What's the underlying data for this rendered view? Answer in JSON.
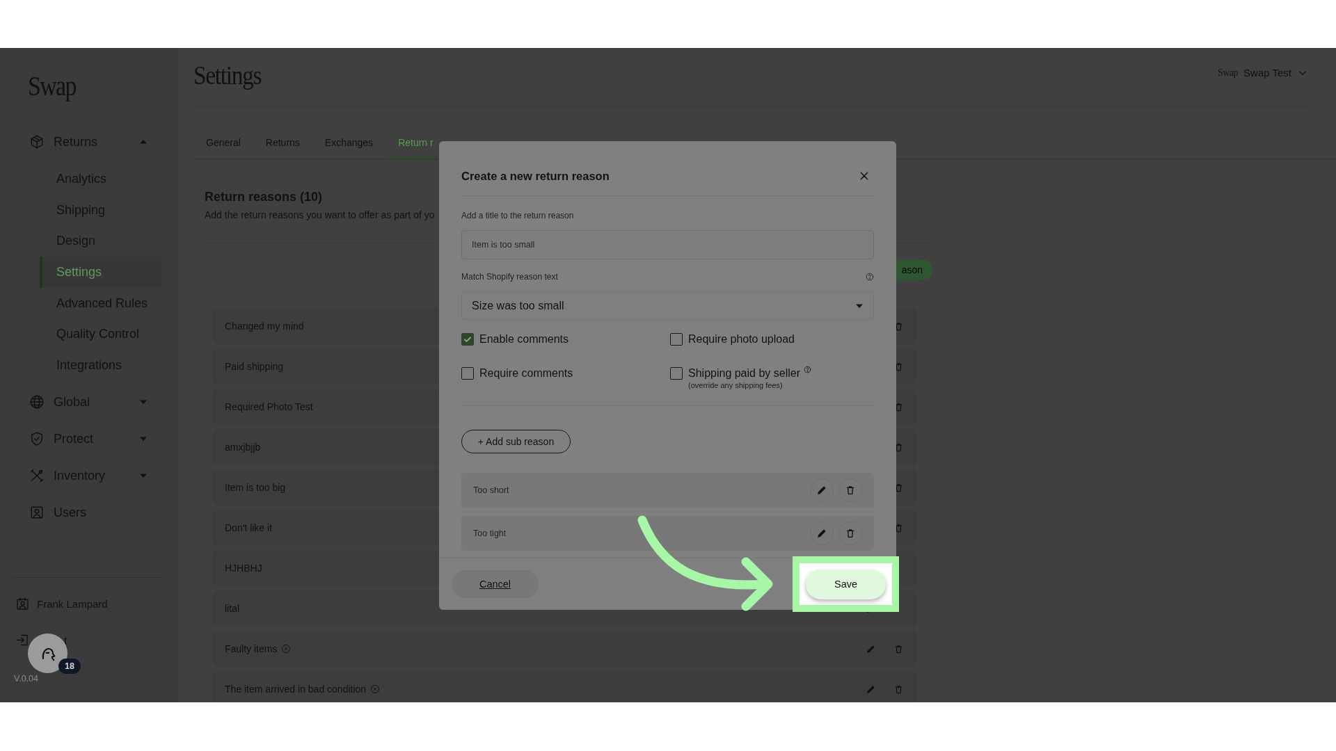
{
  "sidebar": {
    "logo": "Swap",
    "nav": [
      {
        "label": "Returns",
        "expanded": true,
        "children": [
          {
            "label": "Analytics",
            "selected": false
          },
          {
            "label": "Shipping",
            "selected": false
          },
          {
            "label": "Design",
            "selected": false
          },
          {
            "label": "Settings",
            "selected": true
          },
          {
            "label": "Advanced Rules",
            "selected": false
          },
          {
            "label": "Quality Control",
            "selected": false
          },
          {
            "label": "Integrations",
            "selected": false
          }
        ]
      },
      {
        "label": "Global",
        "expanded": false
      },
      {
        "label": "Protect",
        "expanded": false
      },
      {
        "label": "Inventory",
        "expanded": false
      },
      {
        "label": "Users"
      }
    ],
    "user": {
      "name": "Frank Lampard"
    },
    "logout": {
      "label": "t"
    },
    "version": "V.0.04"
  },
  "header": {
    "title": "Settings",
    "account": {
      "logo": "Swap",
      "name": "Swap Test"
    }
  },
  "tabs": [
    {
      "label": "General",
      "selected": false
    },
    {
      "label": "Returns",
      "selected": false
    },
    {
      "label": "Exchanges",
      "selected": false
    },
    {
      "label": "Return r",
      "selected": true
    }
  ],
  "section": {
    "title": "Return reasons (10)",
    "description": "Add the return reasons you want to offer as part of yo",
    "add_button": "ason"
  },
  "reasons": [
    {
      "title": "Changed my mind",
      "flagged": false
    },
    {
      "title": "Paid shipping",
      "flagged": false
    },
    {
      "title": "Required Photo Test",
      "flagged": false
    },
    {
      "title": "amxjbjjb",
      "flagged": false
    },
    {
      "title": "Item is too big",
      "flagged": false
    },
    {
      "title": "Don't like it",
      "flagged": false
    },
    {
      "title": "HJHBHJ",
      "flagged": false
    },
    {
      "title": "lital",
      "flagged": false
    },
    {
      "title": "Faulty items",
      "flagged": true
    },
    {
      "title": "The item arrived in bad condition",
      "flagged": true
    }
  ],
  "dialog": {
    "title": "Create a new return reason",
    "title_field": {
      "label": "Add a title to the return reason",
      "value": "Item is too small"
    },
    "shopify_field": {
      "label": "Match Shopify reason text",
      "value": "Size was too small"
    },
    "options": [
      {
        "label": "Enable comments",
        "checked": true
      },
      {
        "label": "Require photo upload",
        "checked": false
      },
      {
        "label": "Require comments",
        "checked": false
      },
      {
        "label": "Shipping paid by seller",
        "note": "(override any shipping fees)",
        "help": true,
        "checked": false
      }
    ],
    "add_sub_button": "+ Add sub reason",
    "sub_reasons": [
      {
        "title": "Too short"
      },
      {
        "title": "Too tight"
      }
    ],
    "cancel": "Cancel",
    "save": "Save"
  },
  "help_widget": {
    "badge": "18"
  }
}
